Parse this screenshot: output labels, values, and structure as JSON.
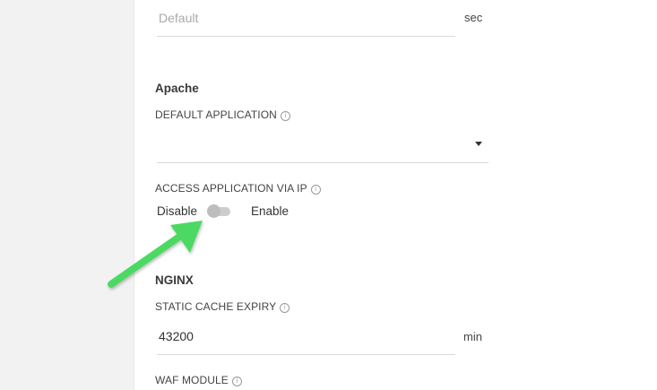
{
  "timeout_field": {
    "placeholder": "Default",
    "unit": "sec"
  },
  "apache": {
    "title": "Apache",
    "default_application": {
      "label": "DEFAULT APPLICATION",
      "value": ""
    },
    "access_via_ip": {
      "label": "ACCESS APPLICATION VIA IP",
      "off_label": "Disable",
      "on_label": "Enable",
      "state": "off"
    }
  },
  "nginx": {
    "title": "NGINX",
    "static_cache_expiry": {
      "label": "STATIC CACHE EXPIRY",
      "value": "43200",
      "unit": "min"
    },
    "waf_module": {
      "label": "WAF MODULE"
    }
  },
  "colors": {
    "annotation_arrow": "#4cd964",
    "panel_bg": "#ffffff",
    "page_bg": "#f2f2f2"
  }
}
